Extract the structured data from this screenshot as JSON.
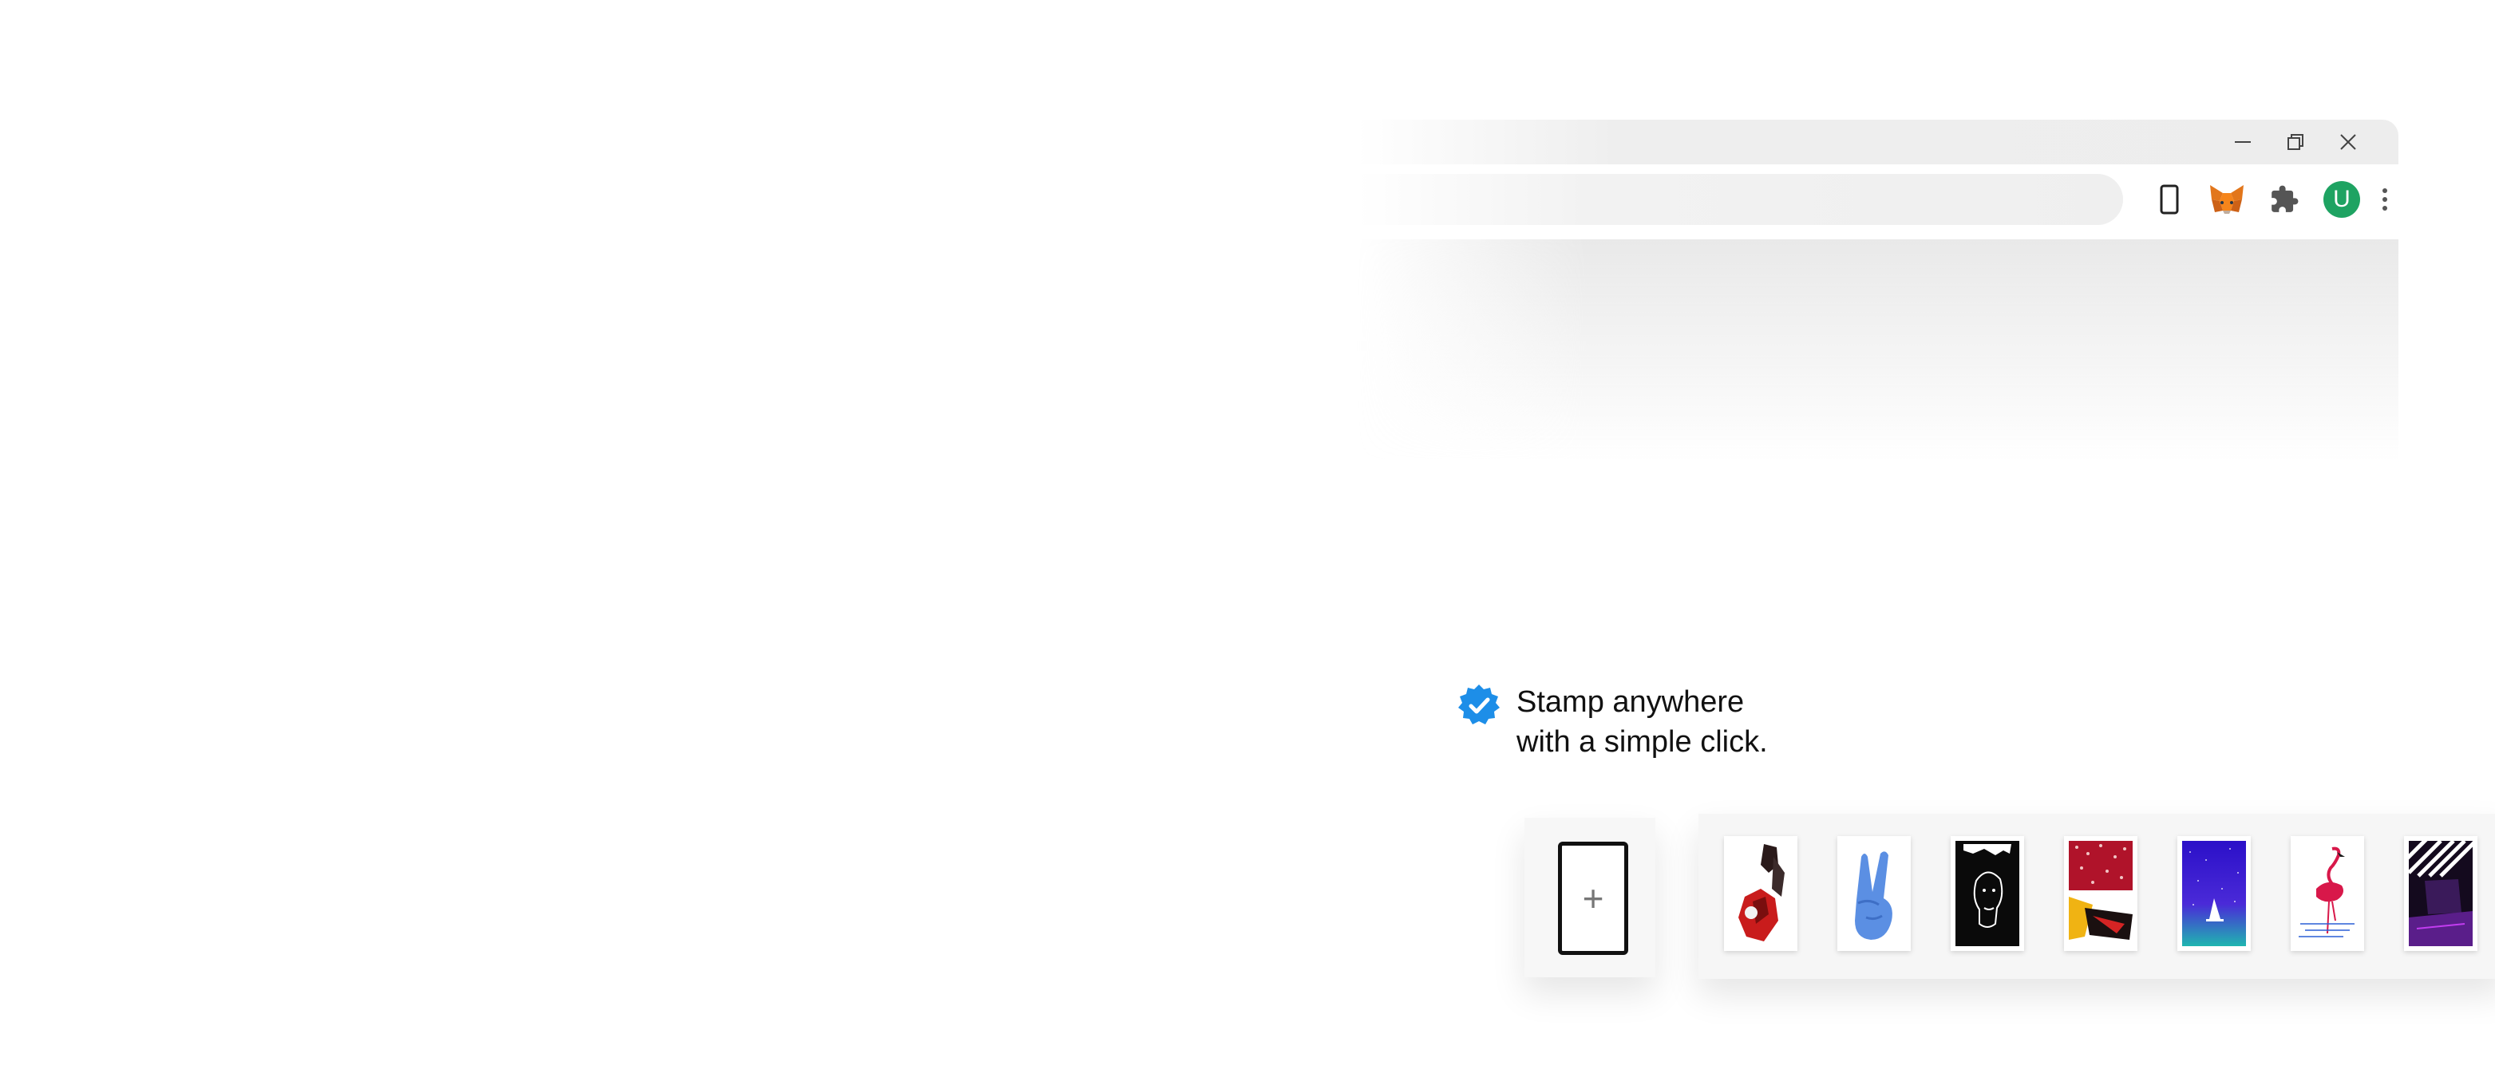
{
  "browser": {
    "window_controls": {
      "minimize_icon": "minimize-icon",
      "restore_icon": "restore-icon",
      "close_icon": "close-icon"
    },
    "toolbar": {
      "extensions": [
        "phone-frame-icon",
        "metamask-fox-icon",
        "puzzle-icon"
      ],
      "profile_initial": "U",
      "menu_icon": "kebab-menu-icon"
    }
  },
  "caption": {
    "line1": "Stamp anywhere",
    "line2": "with a simple click.",
    "badge_icon": "verified-check-badge-icon",
    "badge_color": "#1d8ee8"
  },
  "add_panel": {
    "symbol": "+"
  },
  "stamps": [
    {
      "name": "red-figure-stamp"
    },
    {
      "name": "peace-hand-stamp"
    },
    {
      "name": "black-face-sketch-stamp"
    },
    {
      "name": "red-yellow-abstract-stamp"
    },
    {
      "name": "purple-starry-sailboat-stamp"
    },
    {
      "name": "pink-flamingo-stamp"
    },
    {
      "name": "striped-purple-stamp"
    }
  ],
  "colors": {
    "profile_green": "#1ea362",
    "metamask_orange": "#e2761b"
  }
}
